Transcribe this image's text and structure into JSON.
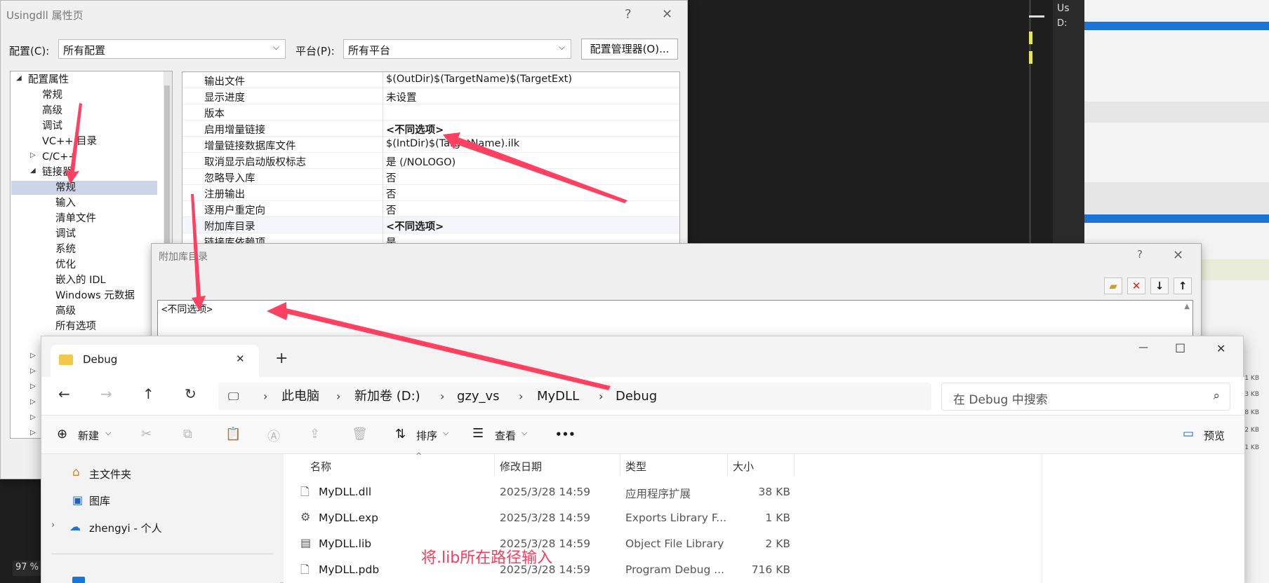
{
  "right_panel": {
    "header_initials": "Us",
    "header_drive": "D:",
    "sizes": [
      "1 KB",
      "3 KB",
      "8 KB",
      "2 KB",
      "1 KB"
    ]
  },
  "status": {
    "zoom": "97 %"
  },
  "props_dialog": {
    "title": "Usingdll 属性页",
    "help": "?",
    "close": "✕",
    "config_label": "配置(C):",
    "config_value": "所有配置",
    "platform_label": "平台(P):",
    "platform_value": "所有平台",
    "config_manager_label": "配置管理器(O)...",
    "tree": [
      {
        "label": "配置属性",
        "indent": 0,
        "icon": "expanded-triangle-icon"
      },
      {
        "label": "常规",
        "indent": 1
      },
      {
        "label": "高级",
        "indent": 1
      },
      {
        "label": "调试",
        "indent": 1
      },
      {
        "label": "VC++ 目录",
        "indent": 1
      },
      {
        "label": "C/C++",
        "indent": 1,
        "icon": "collapsed-triangle-icon"
      },
      {
        "label": "链接器",
        "indent": 1,
        "icon": "expanded-triangle-icon"
      },
      {
        "label": "常规",
        "indent": 2,
        "selected": true
      },
      {
        "label": "输入",
        "indent": 2
      },
      {
        "label": "清单文件",
        "indent": 2
      },
      {
        "label": "调试",
        "indent": 2
      },
      {
        "label": "系统",
        "indent": 2
      },
      {
        "label": "优化",
        "indent": 2
      },
      {
        "label": "嵌入的 IDL",
        "indent": 2
      },
      {
        "label": "Windows 元数据",
        "indent": 2
      },
      {
        "label": "高级",
        "indent": 2
      },
      {
        "label": "所有选项",
        "indent": 2
      }
    ],
    "properties": [
      {
        "name": "输出文件",
        "value": "$(OutDir)$(TargetName)$(TargetExt)"
      },
      {
        "name": "显示进度",
        "value": "未设置"
      },
      {
        "name": "版本",
        "value": ""
      },
      {
        "name": "启用增量链接",
        "value": "<不同选项>",
        "bold": true
      },
      {
        "name": "增量链接数据库文件",
        "value": "$(IntDir)$(TargetName).ilk"
      },
      {
        "name": "取消显示启动版权标志",
        "value": "是 (/NOLOGO)"
      },
      {
        "name": "忽略导入库",
        "value": "否"
      },
      {
        "name": "注册输出",
        "value": "否"
      },
      {
        "name": "逐用户重定向",
        "value": "否"
      },
      {
        "name": "附加库目录",
        "value": "<不同选项>",
        "bold": true,
        "highlight": true
      },
      {
        "name": "链接库依赖项",
        "value": "是"
      }
    ]
  },
  "lib_dialog": {
    "title": "附加库目录",
    "help": "?",
    "close": "✕",
    "edit_value": "<不同选项>"
  },
  "explorer": {
    "tab_title": "Debug",
    "tab_close": "✕",
    "new_tab": "+",
    "min": "—",
    "max": "☐",
    "close": "✕",
    "breadcrumbs": [
      "此电脑",
      "新加卷 (D:)",
      "gzy_vs",
      "MyDLL",
      "Debug"
    ],
    "search_placeholder": "在 Debug 中搜索",
    "toolbar": {
      "new": "新建",
      "sort": "排序",
      "view": "查看",
      "more": "•••",
      "preview": "预览"
    },
    "sidebar": [
      "主文件夹",
      "图库",
      "zhengyi - 个人"
    ],
    "columns": [
      "名称",
      "修改日期",
      "类型",
      "大小"
    ],
    "files": [
      {
        "name": "MyDLL.dll",
        "date": "2025/3/28 14:59",
        "type": "应用程序扩展",
        "size": "38 KB",
        "icon": "dll-file-icon"
      },
      {
        "name": "MyDLL.exp",
        "date": "2025/3/28 14:59",
        "type": "Exports Library F...",
        "size": "1 KB",
        "icon": "exp-file-icon"
      },
      {
        "name": "MyDLL.lib",
        "date": "2025/3/28 14:59",
        "type": "Object File Library",
        "size": "2 KB",
        "icon": "lib-file-icon"
      },
      {
        "name": "MyDLL.pdb",
        "date": "2025/3/28 14:59",
        "type": "Program Debug ...",
        "size": "716 KB",
        "icon": "pdb-file-icon"
      }
    ]
  },
  "annotation": {
    "text": "将.lib所在路径输入",
    "color": "#ff3b5c"
  }
}
